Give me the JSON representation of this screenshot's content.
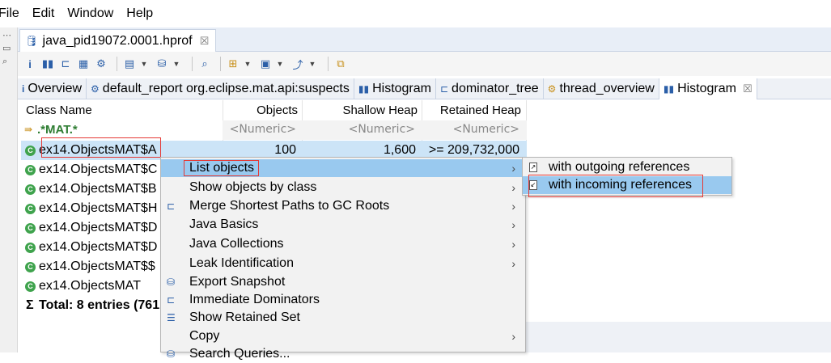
{
  "menubar": {
    "items": [
      "File",
      "Edit",
      "Window",
      "Help"
    ]
  },
  "editor": {
    "tab_label": "java_pid19072.0001.hprof",
    "close": "☒"
  },
  "view_tabs": [
    {
      "label": "Overview",
      "icon": "info-icon"
    },
    {
      "label": "default_report  org.eclipse.mat.api:suspects",
      "icon": "report-icon"
    },
    {
      "label": "Histogram",
      "icon": "histogram-icon"
    },
    {
      "label": "dominator_tree",
      "icon": "dominator-tree-icon"
    },
    {
      "label": "thread_overview",
      "icon": "thread-icon"
    },
    {
      "label": "Histogram",
      "icon": "histogram-icon",
      "active": true
    }
  ],
  "table": {
    "headers": [
      "Class Name",
      "Objects",
      "Shallow Heap",
      "Retained Heap"
    ],
    "filter": {
      "regex": ".*MAT.*",
      "numeric_placeholder": "<Numeric>"
    },
    "rows": [
      {
        "name": "ex14.ObjectsMAT$A",
        "objects": "100",
        "shallow": "1,600",
        "retained": ">= 209,732,000"
      },
      {
        "name": "ex14.ObjectsMAT$C"
      },
      {
        "name": "ex14.ObjectsMAT$B"
      },
      {
        "name": "ex14.ObjectsMAT$H"
      },
      {
        "name": "ex14.ObjectsMAT$D"
      },
      {
        "name": "ex14.ObjectsMAT$D"
      },
      {
        "name": "ex14.ObjectsMAT$$"
      },
      {
        "name": "ex14.ObjectsMAT"
      }
    ],
    "total": "Total: 8 entries (761"
  },
  "context_menu": {
    "items": [
      {
        "label": "List objects",
        "submenu": true
      },
      {
        "label": "Show objects by class",
        "submenu": true
      },
      {
        "label": "Merge Shortest Paths to GC Roots",
        "submenu": true
      },
      {
        "label": "Java Basics",
        "submenu": true
      },
      {
        "label": "Java Collections",
        "submenu": true
      },
      {
        "label": "Leak Identification",
        "submenu": true
      },
      {
        "label": "Export Snapshot"
      },
      {
        "label": "Immediate Dominators"
      },
      {
        "label": "Show Retained Set"
      },
      {
        "label": "Copy",
        "submenu": true
      },
      {
        "label": "Search Queries..."
      }
    ]
  },
  "submenu": {
    "items": [
      {
        "label": "with outgoing references"
      },
      {
        "label": "with incoming references"
      }
    ]
  },
  "colors": {
    "selection": "#cce4f7",
    "menu_highlight": "#99c9ef",
    "annotation": "#e53935",
    "class_icon": "#3fa34d"
  }
}
